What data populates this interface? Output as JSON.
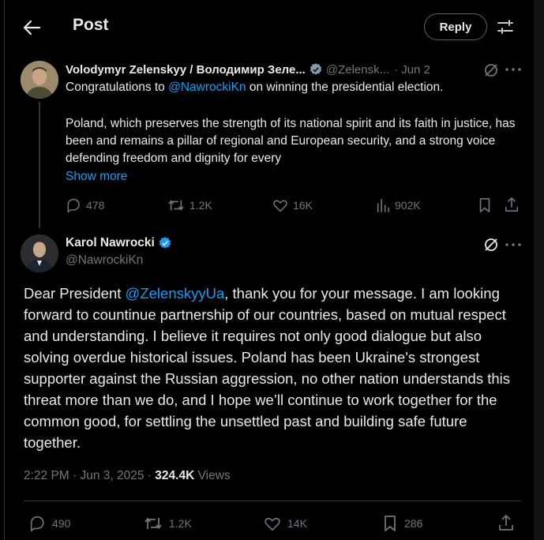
{
  "header": {
    "title": "Post",
    "reply_label": "Reply"
  },
  "parent_tweet": {
    "author_name": "Volodymyr Zelenskyy / Володимир Зеле...",
    "handle": "@Zelensk...",
    "date": "· Jun 2",
    "text_prefix": "Congratulations to ",
    "mention": "@NawrockiKn",
    "text_suffix": " on winning the presidential election.",
    "paragraph": "Poland, which preserves the strength of its national spirit and its faith in justice, has been and remains a pillar of regional and European security, and a strong voice defending freedom and dignity for every",
    "show_more": "Show more",
    "stats": {
      "replies": "478",
      "reposts": "1.2K",
      "likes": "16K",
      "views": "902K"
    }
  },
  "main_tweet": {
    "author_name": "Karol Nawrocki",
    "handle": "@NawrockiKn",
    "text_prefix": "Dear President ",
    "mention": "@ZelenskyyUa",
    "text_suffix": ", thank you for your message. I am looking forward to countinue partnership of our countries, based on mutual respect and understanding. I believe it requires not only good dialogue but also solving overdue historical issues. Poland has been Ukraine's strongest supporter against the Russian aggression, no other nation understands this threat more than we do, and I hope we’ll continue to work together for the common good, for settling the unsettled past and building safe future together.",
    "timestamp": "2:22 PM · Jun 3, 2025 · ",
    "views_count": "324.4K",
    "views_label": " Views",
    "stats": {
      "replies": "490",
      "reposts": "1.2K",
      "likes": "14K",
      "bookmarks": "286"
    }
  },
  "colors": {
    "background": "#000000",
    "text": "#e7e9ea",
    "muted": "#71767b",
    "link": "#1d9bf0",
    "verified": "#1d9bf0"
  },
  "icons": [
    "back-arrow-icon",
    "filter-icon",
    "verified-icon",
    "grok-icon",
    "more-icon",
    "reply-icon",
    "repost-icon",
    "like-icon",
    "views-icon",
    "bookmark-icon",
    "share-icon"
  ]
}
